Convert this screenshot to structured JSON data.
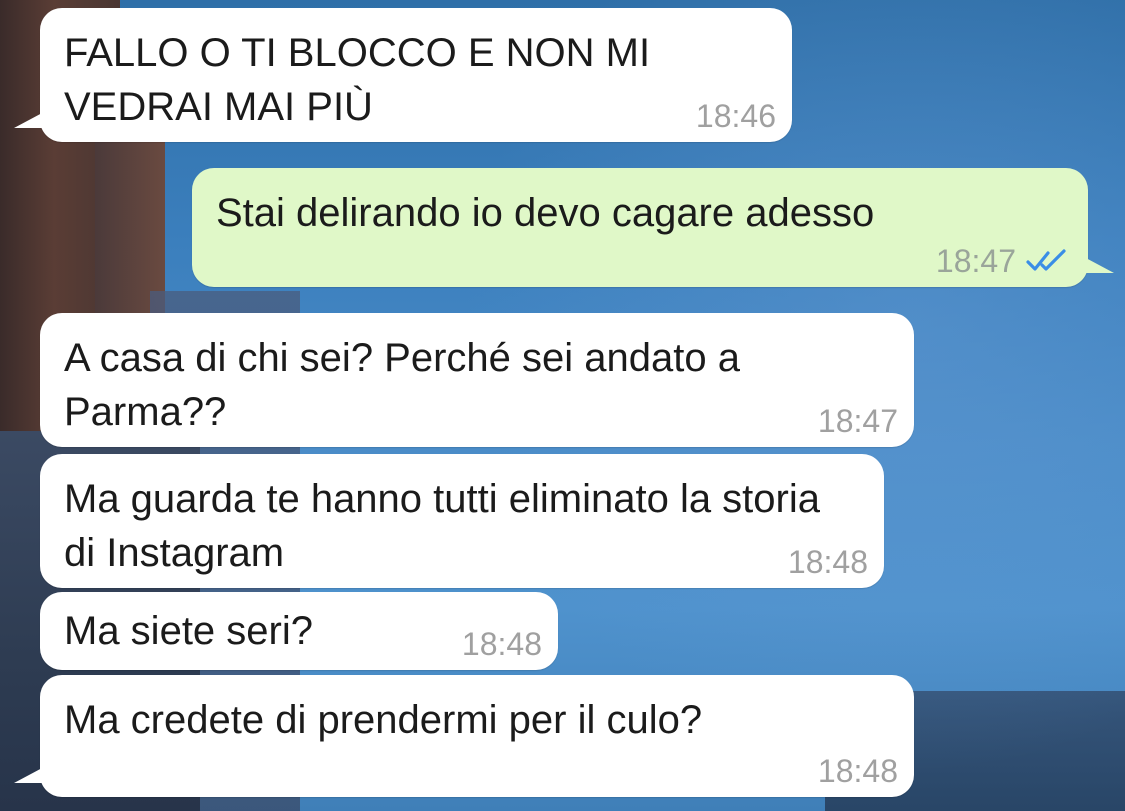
{
  "messages": [
    {
      "direction": "in",
      "text": "FALLO O TI BLOCCO E NON MI VEDRAI MAI PIÙ",
      "time": "18:46"
    },
    {
      "direction": "out",
      "text": "Stai delirando io devo cagare adesso",
      "time": "18:47",
      "status": "read"
    },
    {
      "direction": "in",
      "text": "A casa di chi sei? Perché sei andato a Parma??",
      "time": "18:47"
    },
    {
      "direction": "in",
      "text": "Ma guarda te hanno tutti eliminato la storia di Instagram",
      "time": "18:48"
    },
    {
      "direction": "in",
      "text": "Ma siete seri?",
      "time": "18:48"
    },
    {
      "direction": "in",
      "text": "Ma credete di prendermi per il culo?",
      "time": "18:48"
    }
  ],
  "colors": {
    "incoming_bubble": "#ffffff",
    "outgoing_bubble": "#e0f8c8",
    "read_ticks": "#3a8ee6",
    "timestamp": "#a0a0a0"
  },
  "icons": {
    "read_status": "double-check-icon"
  }
}
